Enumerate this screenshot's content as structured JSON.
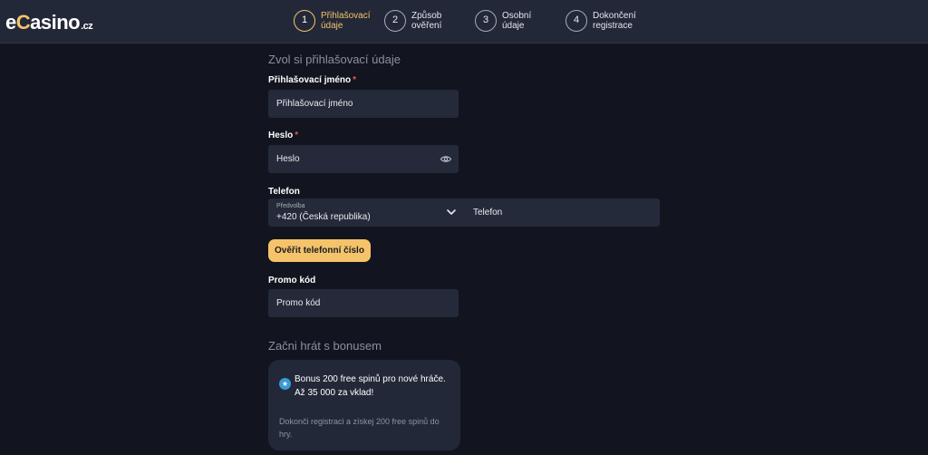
{
  "header": {
    "logo": {
      "pre": "e",
      "accent": "C",
      "post": "asino",
      "suffix": ".cz"
    },
    "steps": [
      {
        "number": "1",
        "line1": "Přihlašovací",
        "line2": "údaje",
        "active": true
      },
      {
        "number": "2",
        "line1": "Způsob",
        "line2": "ověření",
        "active": false
      },
      {
        "number": "3",
        "line1": "Osobní",
        "line2": "údaje",
        "active": false
      },
      {
        "number": "4",
        "line1": "Dokončení",
        "line2": "registrace",
        "active": false
      }
    ]
  },
  "form": {
    "section_title": "Zvol si přihlašovací údaje",
    "username": {
      "label": "Přihlašovací jméno",
      "required_mark": "*",
      "placeholder": "Přihlašovací jméno"
    },
    "password": {
      "label": "Heslo",
      "required_mark": "*",
      "placeholder": "Heslo"
    },
    "phone": {
      "label": "Telefon",
      "prefix_caption": "Předvolba",
      "prefix_value": "+420 (Česká republika)",
      "placeholder": "Telefon"
    },
    "verify_button": "Ověřit telefonní číslo",
    "promo": {
      "label": "Promo kód",
      "placeholder": "Promo kód"
    }
  },
  "bonus": {
    "section_title": "Začni hrát s bonusem",
    "title": "Bonus 200 free spinů pro nové hráče. Až 35 000 za vklad!",
    "note": "Dokonči registraci a získej 200 free spinů do hry.",
    "icon": "star-icon"
  },
  "colors": {
    "background": "#12151f",
    "header": "#232838",
    "input": "#252a3a",
    "accent": "#f5c46a",
    "required": "#e25555",
    "badge": "#3a9ad9"
  }
}
